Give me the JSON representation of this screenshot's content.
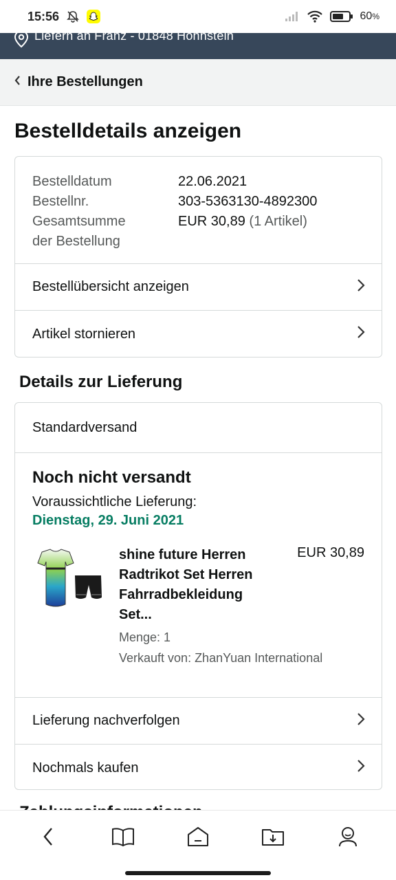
{
  "status_bar": {
    "time": "15:56",
    "battery": "60"
  },
  "deliver_to": {
    "text": "Liefern an Franz - 01848 Hohnstein"
  },
  "back": {
    "label": "Ihre Bestellungen"
  },
  "page_title": "Bestelldetails anzeigen",
  "order_info": {
    "date_label": "Bestelldatum",
    "date_value": "22.06.2021",
    "number_label": "Bestellnr.",
    "number_value": "303-5363130-4892300",
    "total_label_1": "Gesamtsumme",
    "total_label_2": "der Bestellung",
    "total_value": "EUR 30,89",
    "total_count": "(1 Artikel)"
  },
  "order_actions": {
    "overview": "Bestellübersicht anzeigen",
    "cancel": "Artikel stornieren"
  },
  "delivery": {
    "section_title": "Details zur Lieferung",
    "method": "Standardversand",
    "status": "Noch nicht versandt",
    "estimate_label": "Voraussichtliche Lieferung:",
    "estimate_date": "Dienstag, 29. Juni 2021",
    "date_color": "#067d62",
    "item": {
      "title": "shine future Herren Radtrikot Set Herren Fahrradbekleidung Set...",
      "price": "EUR 30,89",
      "qty": "Menge: 1",
      "seller": "Verkauft von: ZhanYuan International"
    },
    "track": "Lieferung nachverfolgen",
    "buy_again": "Nochmals kaufen"
  },
  "next_section_peek": "Zahlungsinformationen",
  "bottom_nav": [
    "back-icon",
    "book-icon",
    "home-icon",
    "download-folder-icon",
    "profile-icon"
  ],
  "colors": {
    "header_bg": "#37475a",
    "accent_green": "#067d62"
  }
}
